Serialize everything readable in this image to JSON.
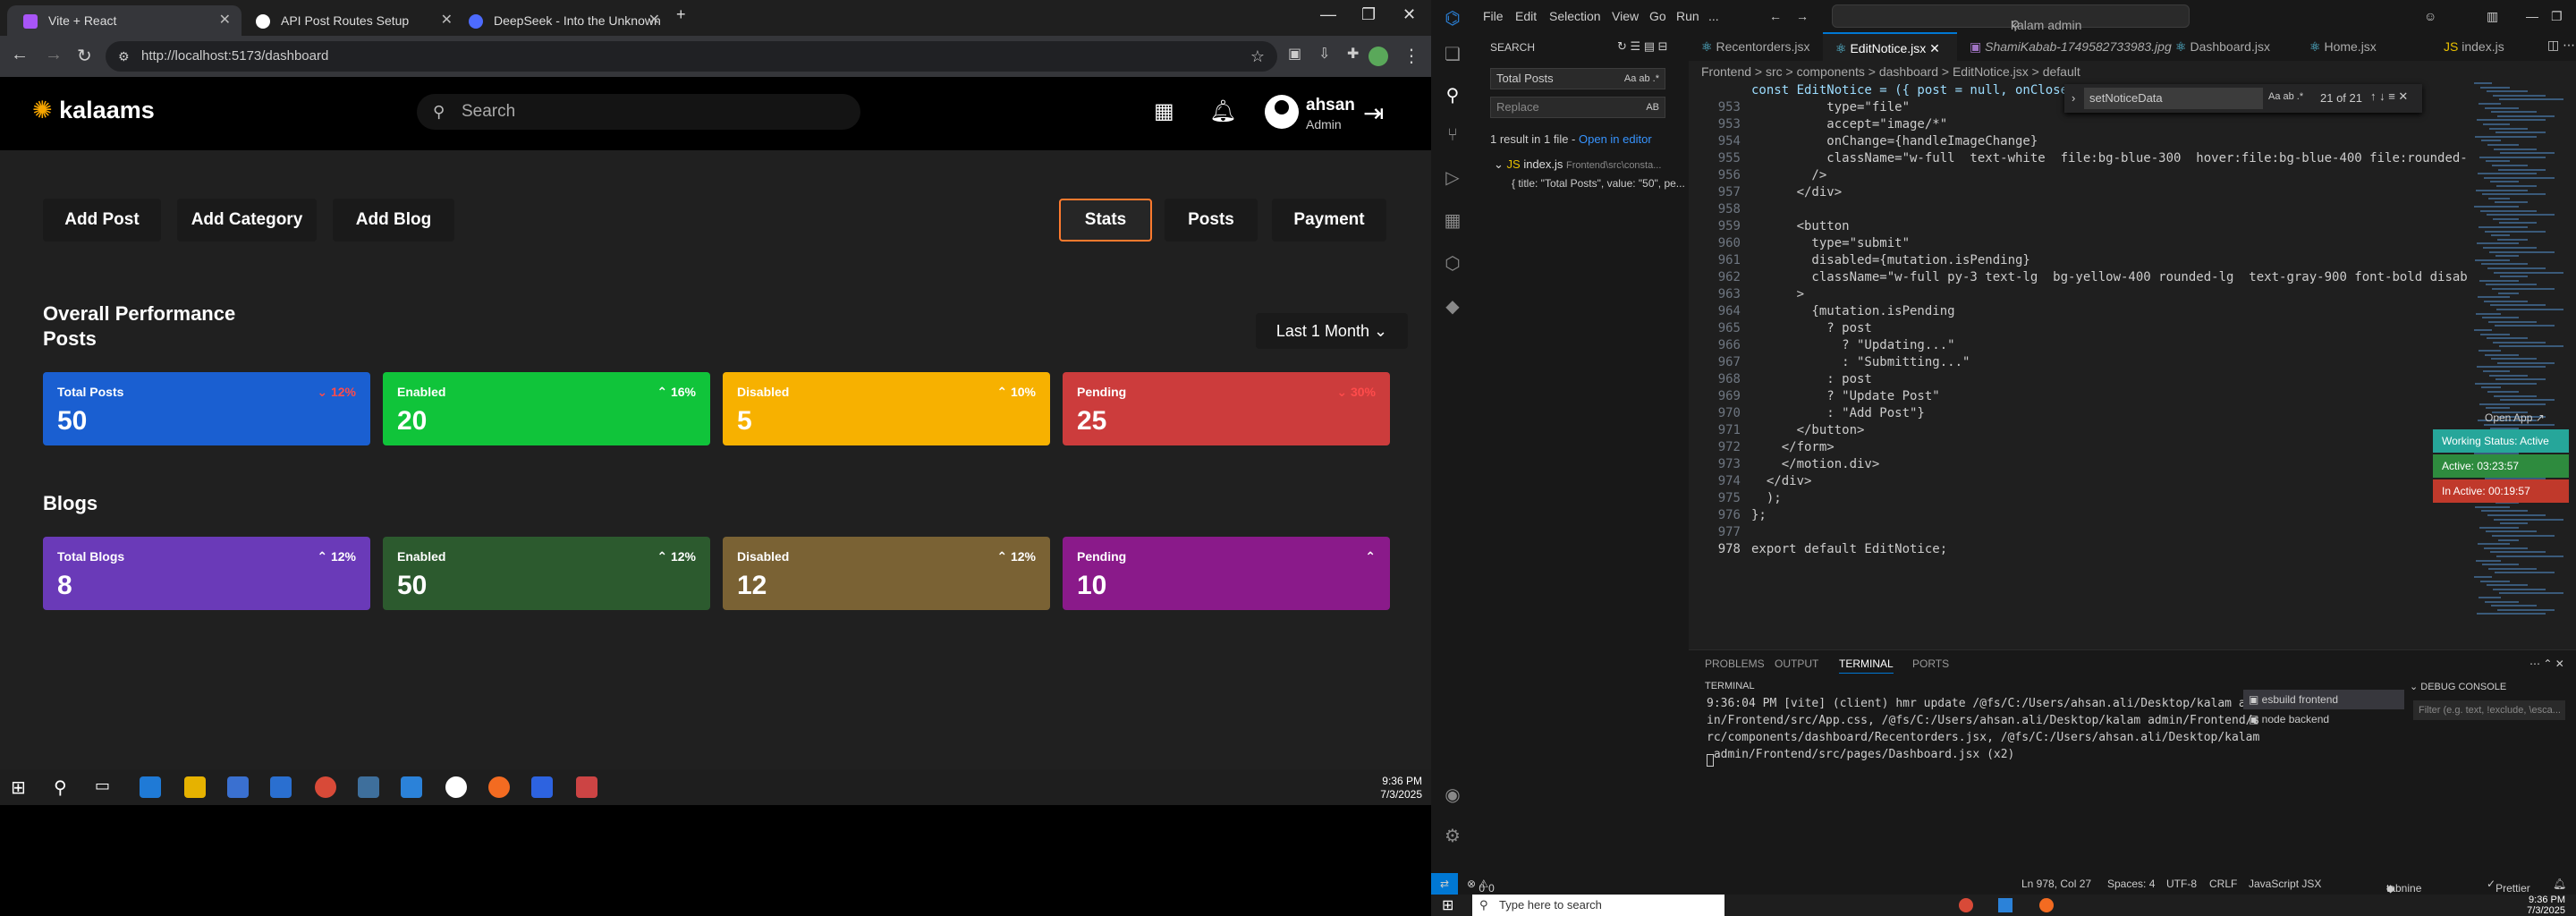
{
  "browser": {
    "tabs": [
      {
        "title": "Vite + React",
        "color": "#a855f7"
      },
      {
        "title": "API Post Routes Setup",
        "color": "#ffffff"
      },
      {
        "title": "DeepSeek - Into the Unknown",
        "color": "#4d6bfe"
      }
    ],
    "url": "http://localhost:5173/dashboard"
  },
  "app": {
    "logo": "kalaams",
    "search_placeholder": "Search",
    "user": {
      "name": "ahsan",
      "role": "Admin"
    },
    "actions": [
      "Add Post",
      "Add Category",
      "Add Blog"
    ],
    "view_tabs": [
      "Stats",
      "Posts",
      "Payment"
    ],
    "section_title": "Overall Performance",
    "posts_title": "Posts",
    "blogs_title": "Blogs",
    "period": "Last 1 Month",
    "posts_cards": [
      {
        "title": "Total Posts",
        "value": "50",
        "pct": "12%",
        "dir": "down",
        "color": "#1a5fd1"
      },
      {
        "title": "Enabled",
        "value": "20",
        "pct": "16%",
        "dir": "up",
        "color": "#10c43a"
      },
      {
        "title": "Disabled",
        "value": "5",
        "pct": "10%",
        "dir": "up",
        "color": "#f7b100"
      },
      {
        "title": "Pending",
        "value": "25",
        "pct": "30%",
        "dir": "down",
        "color": "#cc3c3c"
      }
    ],
    "blogs_cards": [
      {
        "title": "Total Blogs",
        "value": "8",
        "pct": "12%",
        "dir": "up",
        "color": "#6a3ab8"
      },
      {
        "title": "Enabled",
        "value": "50",
        "pct": "12%",
        "dir": "up",
        "color": "#2c5a2e"
      },
      {
        "title": "Disabled",
        "value": "12",
        "pct": "12%",
        "dir": "up",
        "color": "#7a6234"
      },
      {
        "title": "Pending",
        "value": "10",
        "pct": "",
        "dir": "up",
        "color": "#8a1a8a"
      }
    ]
  },
  "taskbar_left": {
    "time": "9:36 PM",
    "date": "7/3/2025"
  },
  "vscode": {
    "menu": [
      "File",
      "Edit",
      "Selection",
      "View",
      "Go",
      "Run",
      "..."
    ],
    "command_center": "kalam admin",
    "search": {
      "label": "SEARCH",
      "query": "Total Posts",
      "replace_placeholder": "Replace",
      "summary": "1 result in 1 file - ",
      "open_in_editor": "Open in editor",
      "file": "index.js",
      "file_path": "Frontend\\src\\consta...",
      "match_line": "{ title: \"Total Posts\", value: \"50\", pe..."
    },
    "tabs": [
      "Recentorders.jsx",
      "EditNotice.jsx",
      "ShamiKabab-1749582733983.jpg",
      "Dashboard.jsx",
      "Home.jsx",
      "index.js"
    ],
    "breadcrumb": "Frontend > src > components > dashboard > EditNotice.jsx > default",
    "sticky_header": "const EditNotice = ({ post = null, onClose }) =>",
    "find": {
      "query": "setNoticeData",
      "count": "21 of 21"
    },
    "code_lines": [
      {
        "n": "953",
        "t": "          type=\"file\""
      },
      {
        "n": "953",
        "t": "          accept=\"image/*\""
      },
      {
        "n": "954",
        "t": "          onChange={handleImageChange}"
      },
      {
        "n": "955",
        "t": "          className=\"w-full  text-white  file:bg-blue-300  hover:file:bg-blue-400 file:rounded-l"
      },
      {
        "n": "956",
        "t": "        />"
      },
      {
        "n": "957",
        "t": "      </div>"
      },
      {
        "n": "958",
        "t": ""
      },
      {
        "n": "959",
        "t": "      <button"
      },
      {
        "n": "960",
        "t": "        type=\"submit\""
      },
      {
        "n": "961",
        "t": "        disabled={mutation.isPending}"
      },
      {
        "n": "962",
        "t": "        className=\"w-full py-3 text-lg  bg-yellow-400 rounded-lg  text-gray-900 font-bold disable"
      },
      {
        "n": "963",
        "t": "      >"
      },
      {
        "n": "964",
        "t": "        {mutation.isPending"
      },
      {
        "n": "965",
        "t": "          ? post"
      },
      {
        "n": "966",
        "t": "            ? \"Updating...\""
      },
      {
        "n": "967",
        "t": "            : \"Submitting...\""
      },
      {
        "n": "968",
        "t": "          : post"
      },
      {
        "n": "969",
        "t": "          ? \"Update Post\""
      },
      {
        "n": "970",
        "t": "          : \"Add Post\"}"
      },
      {
        "n": "971",
        "t": "      </button>"
      },
      {
        "n": "972",
        "t": "    </form>"
      },
      {
        "n": "973",
        "t": "    </motion.div>"
      },
      {
        "n": "974",
        "t": "  </div>"
      },
      {
        "n": "975",
        "t": "  );"
      },
      {
        "n": "976",
        "t": "};"
      },
      {
        "n": "977",
        "t": ""
      },
      {
        "n": "978",
        "t": "export default EditNotice;"
      }
    ],
    "widget": {
      "open_app": "Open App",
      "working": "Working Status: Active",
      "active": "Active: 03:23:57",
      "inactive": "In Active: 00:19:57"
    },
    "panel_tabs": [
      "PROBLEMS",
      "OUTPUT",
      "TERMINAL",
      "PORTS"
    ],
    "terminal_title": "TERMINAL",
    "terminal_text": "9:36:04 PM [vite] (client) hmr update /@fs/C:/Users/ahsan.ali/Desktop/kalam adm\nin/Frontend/src/App.css, /@fs/C:/Users/ahsan.ali/Desktop/kalam admin/Frontend/s\nrc/components/dashboard/Recentorders.jsx, /@fs/C:/Users/ahsan.ali/Desktop/kalam\n admin/Frontend/src/pages/Dashboard.jsx (x2)",
    "terminals": [
      "esbuild  frontend",
      "node  backend"
    ],
    "debug_title": "DEBUG CONSOLE",
    "debug_filter": "Filter (e.g. text, !exclude, \\esca...",
    "status": {
      "errors": "0",
      "warnings": "0",
      "position": "Ln 978, Col 27",
      "spaces": "Spaces: 4",
      "encoding": "UTF-8",
      "eol": "CRLF",
      "language": "JavaScript JSX",
      "tabnine": "tabnine basic",
      "prettier": "Prettier"
    }
  },
  "taskbar_right": {
    "search": "Type here to search",
    "time": "9:36 PM",
    "date": "7/3/2025"
  }
}
